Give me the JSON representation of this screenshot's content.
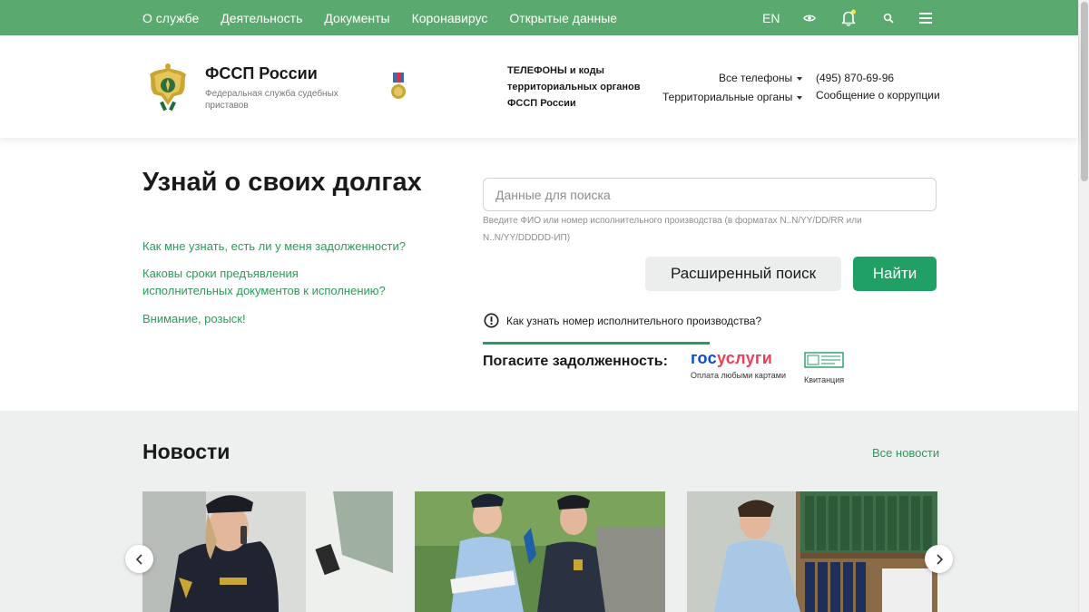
{
  "topnav": {
    "items": [
      {
        "label": "О службе"
      },
      {
        "label": "Деятельность"
      },
      {
        "label": "Документы"
      },
      {
        "label": "Коронавирус"
      },
      {
        "label": "Открытые данные"
      }
    ],
    "lang": "EN",
    "icons": [
      "eye-icon",
      "bell-icon",
      "search-icon",
      "menu-icon"
    ],
    "colors": {
      "bar": "#5aaa6f",
      "notify_dot": "#f5e84a"
    }
  },
  "header": {
    "title": "ФССП России",
    "subtitle": "Федеральная служба судебных приставов",
    "phones_title": "ТЕЛЕФОНЫ и коды территориальных органов ФССП России",
    "all_phones": "Все телефоны",
    "territorial": "Территориальные органы",
    "phone": "(495) 870-69-96",
    "corruption": "Сообщение о коррупции"
  },
  "hero": {
    "title": "Узнай о своих долгах",
    "links": [
      "Как мне узнать, есть ли у меня задолженности?",
      "Каковы сроки предъявления исполнительных документов к исполнению?",
      "Внимание, розыск!"
    ],
    "search_placeholder": "Данные для поиска",
    "search_value": "",
    "search_hint": "Введите ФИО или номер исполнительного производства (в форматах N..N/YY/DD/RR или N..N/YY/DDDDD-ИП)",
    "advanced_label": "Расширенный поиск",
    "find_label": "Найти",
    "howto_label": "Как узнать номер исполнительного производства?",
    "pay_label": "Погасите задолженность:",
    "gosuslugi_logo_a": "гос",
    "gosuslugi_logo_b": "услуги",
    "gosuslugi_caption": "Оплата любыми картами",
    "kvit_caption": "Квитанция",
    "colors": {
      "accent": "#21a065",
      "link": "#2d9a5a"
    }
  },
  "news": {
    "title": "Новости",
    "all_label": "Все новости"
  }
}
